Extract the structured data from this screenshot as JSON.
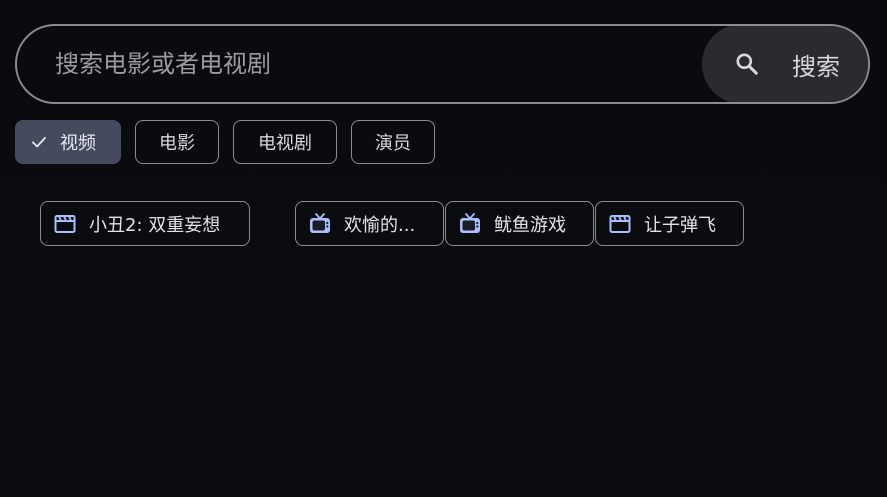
{
  "search": {
    "placeholder": "搜索电影或者电视剧",
    "button_label": "搜索"
  },
  "filters": [
    {
      "label": "视频",
      "selected": true
    },
    {
      "label": "电影",
      "selected": false
    },
    {
      "label": "电视剧",
      "selected": false
    },
    {
      "label": "演员",
      "selected": false
    }
  ],
  "results": [
    {
      "label": "小丑2: 双重妄想",
      "icon": "movie-clapper-icon"
    },
    {
      "label": "欢愉的...",
      "icon": "tv-icon"
    },
    {
      "label": "鱿鱼游戏",
      "icon": "tv-icon"
    },
    {
      "label": "让子弹飞",
      "icon": "movie-clapper-icon"
    }
  ],
  "colors": {
    "background": "#0b0c10",
    "outline": "#8b8c93",
    "selected_chip": "#454a5c",
    "search_button": "#2a2b2f",
    "icon_accent": "#a8c0ff"
  }
}
